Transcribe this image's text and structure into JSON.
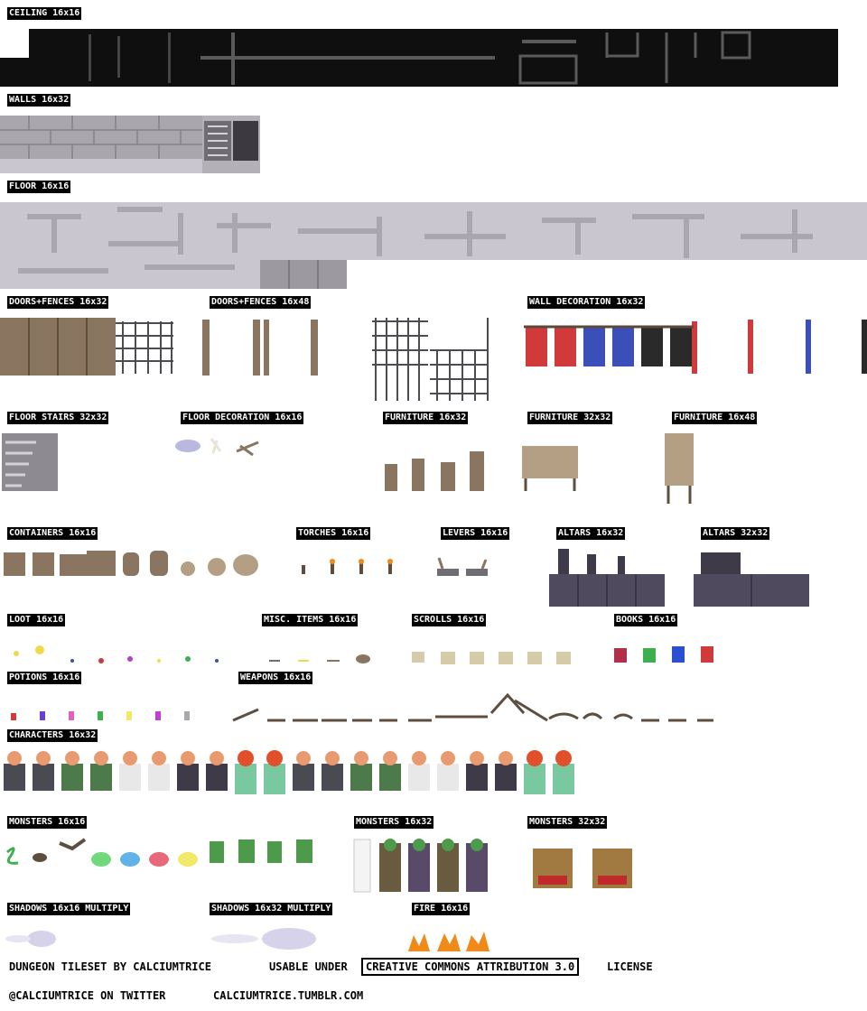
{
  "sections": {
    "ceiling": "CEILING 16x16",
    "walls": "WALLS 16x32",
    "floor": "FLOOR 16x16",
    "doors_fences_32": "DOORS+FENCES 16x32",
    "doors_fences_48": "DOORS+FENCES 16x48",
    "wall_decoration": "WALL DECORATION 16x32",
    "floor_stairs": "FLOOR STAIRS 32x32",
    "floor_decoration": "FLOOR DECORATION 16x16",
    "furniture_16x32": "FURNITURE 16x32",
    "furniture_32x32": "FURNITURE 32x32",
    "furniture_16x48": "FURNITURE 16x48",
    "containers": "CONTAINERS 16x16",
    "torches": "TORCHES 16x16",
    "levers": "LEVERS 16x16",
    "altars_16x32": "ALTARS 16x32",
    "altars_32x32": "ALTARS 32x32",
    "loot": "LOOT 16x16",
    "misc_items": "MISC. ITEMS 16x16",
    "scrolls": "SCROLLS 16x16",
    "books": "BOOKS 16x16",
    "potions": "POTIONS 16x16",
    "weapons": "WEAPONS 16x16",
    "characters": "CHARACTERS 16x32",
    "monsters_16x16": "MONSTERS 16x16",
    "monsters_16x32": "MONSTERS 16x32",
    "monsters_32x32": "MONSTERS 32x32",
    "shadows_16x16": "SHADOWS 16x16 MULTIPLY",
    "shadows_16x32": "SHADOWS 16x32 MULTIPLY",
    "fire": "FIRE 16x16"
  },
  "footer": {
    "credit": "DUNGEON TILESET BY CALCIUMTRICE",
    "usable_under": "USABLE UNDER",
    "license_name": "CREATIVE COMMONS ATTRIBUTION 3.0",
    "license_word": "LICENSE",
    "twitter": "@CALCIUMTRICE ON TWITTER",
    "site": "CALCIUMTRICE.TUMBLR.COM"
  },
  "colors": {
    "ceiling": "#0f0f0f",
    "stone": "#a9a6ad",
    "floor": "#c9c6cf",
    "wood": "#8a7560",
    "banner_red": "#d13a3a",
    "banner_blue": "#3b4fb8",
    "banner_black": "#2a2a2a",
    "slime_green": "#6fd97c",
    "slime_blue": "#5fb3e8",
    "slime_red": "#e86a7a",
    "slime_yellow": "#f2e86a",
    "goblin": "#4c9a4a",
    "fire": "#f08a1a"
  }
}
